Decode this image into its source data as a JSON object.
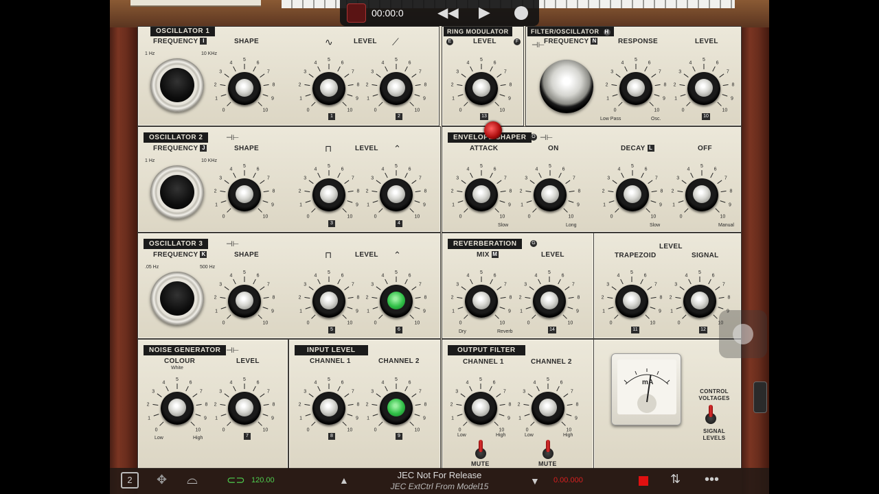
{
  "transport": {
    "time": "00:00:0",
    "rewind_icon": "rewind-icon",
    "play_icon": "play-icon",
    "record_icon": "record-icon",
    "grid_icon": "grid-icon"
  },
  "osc1": {
    "title": "OSCILLATOR 1",
    "frequency_label": "FREQUENCY",
    "frequency_tag": "I",
    "range_low": "1 Hz",
    "range_high": "10 KHz",
    "shape_label": "SHAPE",
    "level_label": "LEVEL",
    "level1_tag": "1",
    "level2_tag": "2"
  },
  "ring_mod": {
    "title": "RING MODULATOR",
    "level_label": "LEVEL",
    "tag_e": "E",
    "tag_f": "F",
    "level_tag": "13"
  },
  "filter": {
    "title": "FILTER/OSCILLATOR",
    "title_tag": "H",
    "frequency_label": "FREQUENCY",
    "frequency_tag": "N",
    "response_label": "RESPONSE",
    "level_label": "LEVEL",
    "low_pass": "Low Pass",
    "osc": "Osc.",
    "level_tag": "10"
  },
  "osc2": {
    "title": "OSCILLATOR 2",
    "frequency_label": "FREQUENCY",
    "frequency_tag": "J",
    "range_low": "1 Hz",
    "range_high": "10 KHz",
    "shape_label": "SHAPE",
    "level_label": "LEVEL",
    "level1_tag": "3",
    "level2_tag": "4"
  },
  "envelope": {
    "title": "ENVELOPE SHAPER",
    "title_tag": "O",
    "attack_label": "ATTACK",
    "on_label": "ON",
    "decay_label": "DECAY",
    "decay_tag": "L",
    "off_label": "OFF",
    "slow1": "Slow",
    "long": "Long",
    "slow2": "Slow",
    "manual": "Manual"
  },
  "osc3": {
    "title": "OSCILLATOR 3",
    "frequency_label": "FREQUENCY",
    "frequency_tag": "K",
    "range_low": ".05 Hz",
    "range_high": "500 Hz",
    "shape_label": "SHAPE",
    "level_label": "LEVEL",
    "level1_tag": "5",
    "level2_tag": "6"
  },
  "reverb": {
    "title": "REVERBERATION",
    "title_tag": "G",
    "mix_label": "MIX",
    "mix_tag": "M",
    "level_label": "LEVEL",
    "dry": "Dry",
    "reverb": "Reverb",
    "level_tag": "14"
  },
  "level_group": {
    "level_label": "LEVEL",
    "trapezoid_label": "TRAPEZOID",
    "signal_label": "SIGNAL",
    "trap_tag": "11",
    "signal_tag": "12"
  },
  "noise": {
    "title": "NOISE GENERATOR",
    "colour_label": "COLOUR",
    "white": "White",
    "level_label": "LEVEL",
    "low": "Low",
    "high": "High",
    "level_tag": "7"
  },
  "input": {
    "title": "INPUT LEVEL",
    "ch1_label": "CHANNEL 1",
    "ch2_label": "CHANNEL 2",
    "ch1_tag": "8",
    "ch2_tag": "9"
  },
  "output": {
    "title": "OUTPUT FILTER",
    "ch1_label": "CHANNEL 1",
    "ch2_label": "CHANNEL 2",
    "low1": "Low",
    "high1": "High",
    "low2": "Low",
    "high2": "High",
    "mute1": "MUTE",
    "mute2": "MUTE"
  },
  "meter": {
    "unit": "mA"
  },
  "control_switch": {
    "top_label_1": "CONTROL",
    "top_label_2": "VOLTAGES",
    "bottom_label_1": "SIGNAL",
    "bottom_label_2": "LEVELS"
  },
  "bottom_bar": {
    "tempo": "120.00",
    "preset_name": "JEC Not For Release",
    "preset_sub": "JEC ExtCtrl From Model15",
    "counter": "0.00.000",
    "icons": [
      "pages-icon",
      "move-icon",
      "keyboard-icon",
      "link-icon",
      "up-arrow-icon",
      "down-arrow-icon",
      "stop-icon",
      "swap-icon",
      "more-icon"
    ]
  },
  "colors": {
    "panel": "#e5e0d0",
    "wood": "#6a2d1d",
    "green_knob": "#2fbf46",
    "lamp": "#c01818",
    "tempo_green": "#4fd04f",
    "counter_red": "#d82020"
  }
}
